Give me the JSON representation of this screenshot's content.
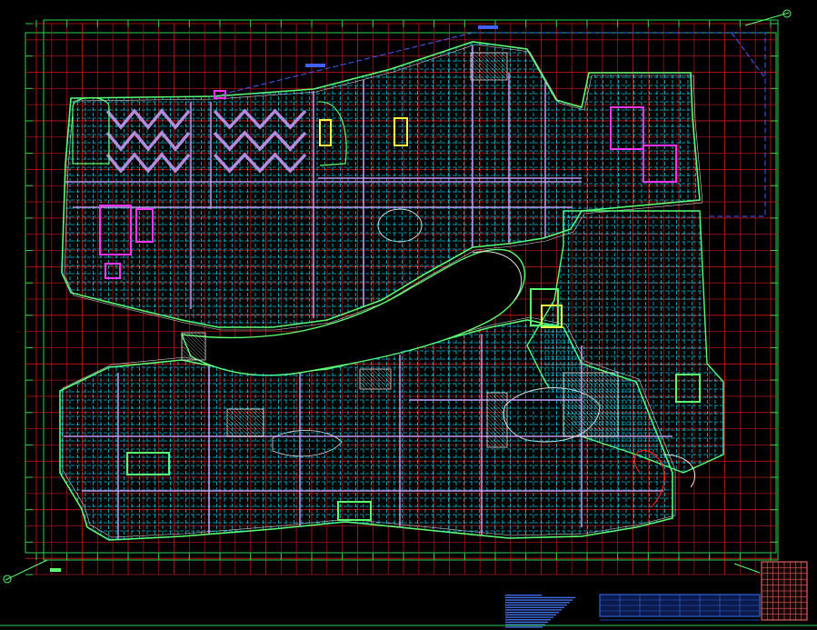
{
  "drawing": {
    "kind": "architectural-structural-floor-plan",
    "background": "#000000",
    "colors": {
      "grid": "#ff1a1a",
      "grid_secondary": "#c01818",
      "frame": "#2bd44a",
      "outline": "#5cff70",
      "beam": "#00e5ff",
      "wall": "#e0e0e0",
      "hatch": "#d0a0ff",
      "magenta": "#ff33ff",
      "yellow": "#ffff40",
      "blue": "#4060ff",
      "notes": "#4a7cff",
      "title_block": "#2f60d8",
      "key_plan": "#ff7070"
    },
    "grid": {
      "x_count": 48,
      "y_count": 34
    },
    "icons": [
      "north-arrow-icon",
      "section-marker-icon"
    ]
  }
}
